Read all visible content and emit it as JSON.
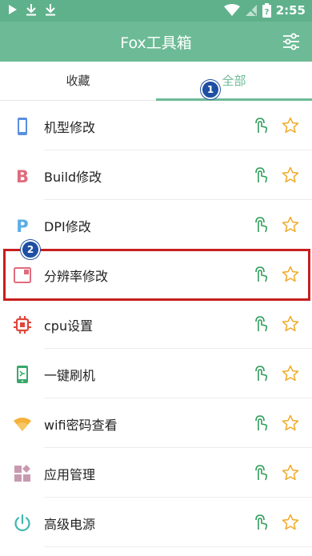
{
  "status_bar": {
    "time": "2:55"
  },
  "app_bar": {
    "title": "Fox工具箱"
  },
  "tabs": [
    {
      "label": "收藏"
    },
    {
      "label": "全部"
    }
  ],
  "annotations": [
    {
      "number": "1"
    },
    {
      "number": "2"
    }
  ],
  "items": [
    {
      "label": "机型修改",
      "icon": "phone-icon",
      "color": "#5b8fe0"
    },
    {
      "label": "Build修改",
      "icon": "letter-b-icon",
      "color": "#e06b7c"
    },
    {
      "label": "DPI修改",
      "icon": "letter-p-icon",
      "color": "#5aaee6"
    },
    {
      "label": "分辨率修改",
      "icon": "window-icon",
      "color": "#e06b7c"
    },
    {
      "label": "cpu设置",
      "icon": "chip-icon",
      "color": "#e0463c"
    },
    {
      "label": "一键刷机",
      "icon": "flash-phone-icon",
      "color": "#38a86b"
    },
    {
      "label": "wifi密码查看",
      "icon": "wifi-icon",
      "color": "#f4b23a"
    },
    {
      "label": "应用管理",
      "icon": "apps-icon",
      "color": "#c89ab0"
    },
    {
      "label": "高级电源",
      "icon": "power-icon",
      "color": "#3fb7b0"
    }
  ],
  "colors": {
    "primary": "#6dbb96",
    "status_bar": "#5fb18b",
    "highlight": "#c81e1e",
    "badge": "#1e4fa3",
    "run": "#2f9d5a",
    "star": "#f0a928"
  }
}
